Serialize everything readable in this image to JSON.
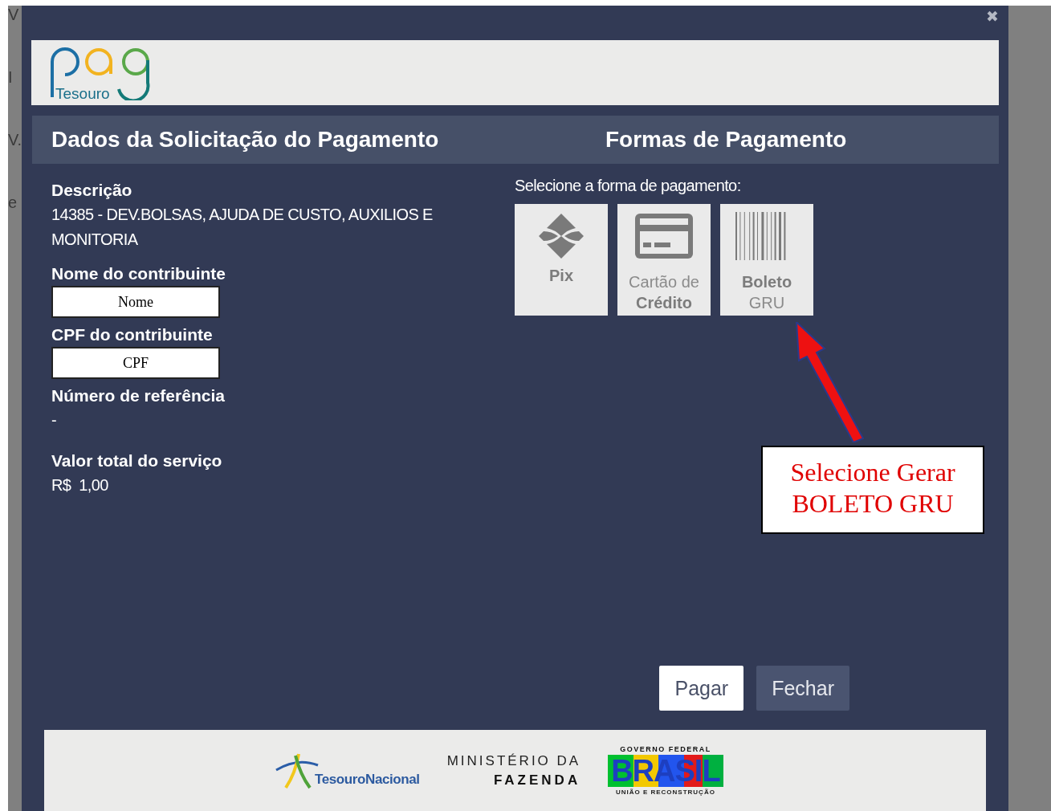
{
  "background_page": {
    "margin_fragments": [
      "V",
      "I",
      "V.",
      "e"
    ]
  },
  "modal": {
    "close": "✖",
    "logo_text": "Tesouro",
    "left_header": "Dados da Solicitação do Pagamento",
    "right_header": "Formas de Pagamento",
    "fields": [
      {
        "kind": "text",
        "label": "Descrição",
        "value": "14385 - DEV.BOLSAS, AJUDA DE CUSTO, AUXILIOS E MONITORIA"
      },
      {
        "kind": "input",
        "label": "Nome do contribuinte",
        "placeholder": "Nome"
      },
      {
        "kind": "input",
        "label": "CPF do contribuinte",
        "placeholder": "CPF"
      },
      {
        "kind": "text",
        "label": "Número de referência",
        "value": "-"
      },
      {
        "kind": "text",
        "label": "Valor total do serviço",
        "value": "R$  1,00"
      }
    ],
    "payment_prompt": "Selecione a forma de pagamento:",
    "payment_options": [
      {
        "kind": "pix",
        "label": "**Pix**"
      },
      {
        "kind": "card",
        "label": "Cartão de **Crédito**"
      },
      {
        "kind": "boleto",
        "label": "**Boleto** GRU"
      }
    ],
    "buttons": [
      {
        "label": "Pagar",
        "primary": true
      },
      {
        "label": "Fechar",
        "primary": false
      }
    ],
    "footer": {
      "tesouro": "TesouroNacional",
      "ministry_line1": "MINISTÉRIO DA",
      "ministry_line2": "FAZENDA",
      "gov_top": "GOVERNO FEDERAL",
      "gov_word": "BRASIL",
      "gov_bottom": "UNIÃO E RECONSTRUÇÃO"
    }
  },
  "annotation": {
    "text": "Selecione Gerar BOLETO GRU"
  }
}
